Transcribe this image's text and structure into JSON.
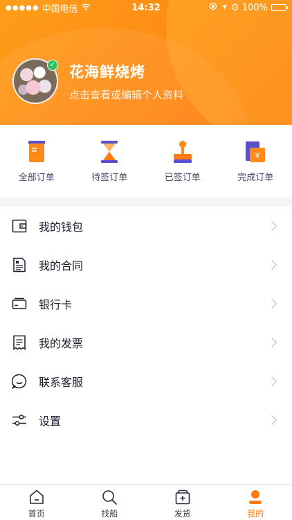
{
  "status_bar": {
    "carrier": "中国电信",
    "time": "14:32",
    "battery": "100%"
  },
  "profile": {
    "name": "花海鲜烧烤",
    "subtitle": "点击查看或编辑个人资料"
  },
  "orders": [
    {
      "label": "全部订单",
      "icon": "all-orders-icon"
    },
    {
      "label": "待签订单",
      "icon": "pending-sign-icon"
    },
    {
      "label": "已签订单",
      "icon": "signed-stamp-icon"
    },
    {
      "label": "完成订单",
      "icon": "completed-order-icon"
    }
  ],
  "menu": [
    {
      "label": "我的钱包",
      "icon": "wallet-icon"
    },
    {
      "label": "我的合同",
      "icon": "contract-icon"
    },
    {
      "label": "银行卡",
      "icon": "bank-card-icon"
    },
    {
      "label": "我的发票",
      "icon": "invoice-icon"
    },
    {
      "label": "联系客服",
      "icon": "customer-service-icon"
    },
    {
      "label": "设置",
      "icon": "settings-icon"
    }
  ],
  "tabbar": [
    {
      "label": "首页",
      "icon": "home-icon"
    },
    {
      "label": "找船",
      "icon": "search-icon"
    },
    {
      "label": "发货",
      "icon": "ship-cargo-icon"
    },
    {
      "label": "我的",
      "icon": "profile-icon",
      "active": true
    }
  ],
  "colors": {
    "accent": "#ff7a10",
    "order_icon_purple": "#5a4fcf",
    "order_icon_orange": "#ff8a1a"
  }
}
